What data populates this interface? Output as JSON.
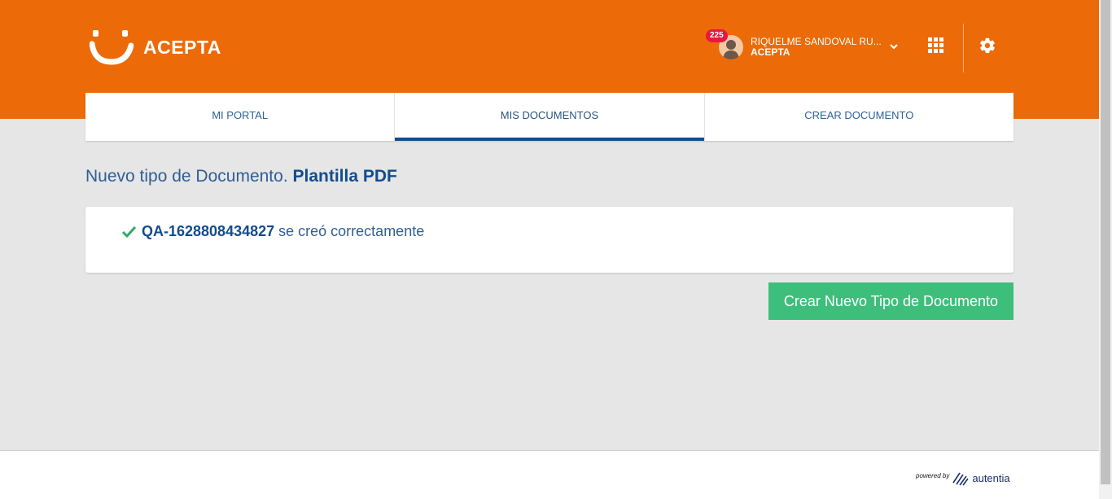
{
  "brand": {
    "name": "ACEPTA",
    "accent": "#ec6b08"
  },
  "user": {
    "badge_count": "225",
    "name": "RIQUELME SANDOVAL RU...",
    "org": "ACEPTA"
  },
  "icons": {
    "apps": "grid-icon",
    "settings": "gear-icon",
    "user_menu": "chevron-down-icon",
    "success": "check-icon"
  },
  "tabs": [
    {
      "label": "MI PORTAL"
    },
    {
      "label": "MIS DOCUMENTOS",
      "active": true
    },
    {
      "label": "CREAR DOCUMENTO"
    }
  ],
  "main": {
    "title_prefix": "Nuevo tipo de Documento.",
    "title_bold": "Plantilla PDF",
    "message_id": "QA-1628808434827",
    "message_text": "se creó correctamente",
    "create_button": "Crear Nuevo Tipo de Documento"
  },
  "footer": {
    "powered_by": "powered by",
    "vendor": "autentia"
  }
}
